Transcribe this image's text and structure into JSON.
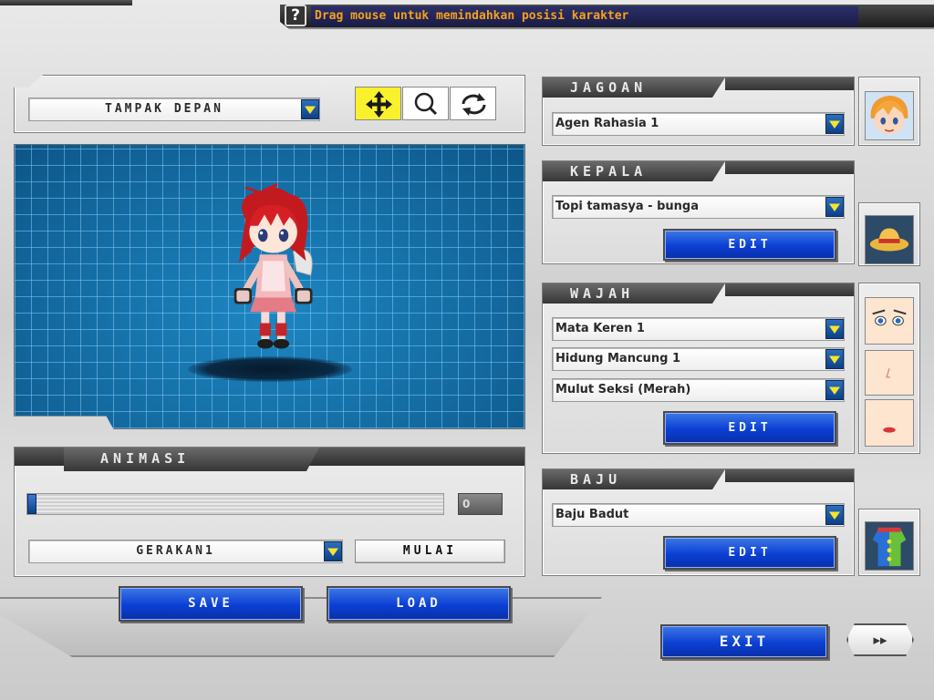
{
  "help": {
    "icon_glyph": "?",
    "message": "Drag mouse untuk memindahkan posisi karakter",
    "message_color": "#f6a11b"
  },
  "view": {
    "selected": "TAMPAK DEPAN",
    "tools": [
      "move-tool",
      "zoom-tool",
      "rotate-tool"
    ]
  },
  "animation": {
    "title": "ANIMASI",
    "frame_value": "0",
    "slider_fraction": 0.0,
    "motion_selected": "GERAKAN1",
    "start_label": "MULAI"
  },
  "actions": {
    "save_label": "SAVE",
    "load_label": "LOAD",
    "exit_label": "EXIT",
    "next_glyph": "▸▸"
  },
  "sections": {
    "jagoan": {
      "title": "JAGOAN",
      "selected": "Agen Rahasia 1"
    },
    "kepala": {
      "title": "KEPALA",
      "selected": "Topi tamasya - bunga",
      "edit_label": "EDIT"
    },
    "wajah": {
      "title": "WAJAH",
      "eyes": "Mata Keren 1",
      "nose": "Hidung Mancung 1",
      "mouth": "Mulut Seksi (Merah)",
      "edit_label": "EDIT"
    },
    "baju": {
      "title": "BAJU",
      "selected": "Baju Badut",
      "edit_label": "EDIT"
    }
  },
  "colors": {
    "viewport_blue": "#1a6fa6",
    "button_blue": "#0b3fd3",
    "dropdown_arrow": "#f4e52e",
    "active_tool": "#f9f12b"
  }
}
